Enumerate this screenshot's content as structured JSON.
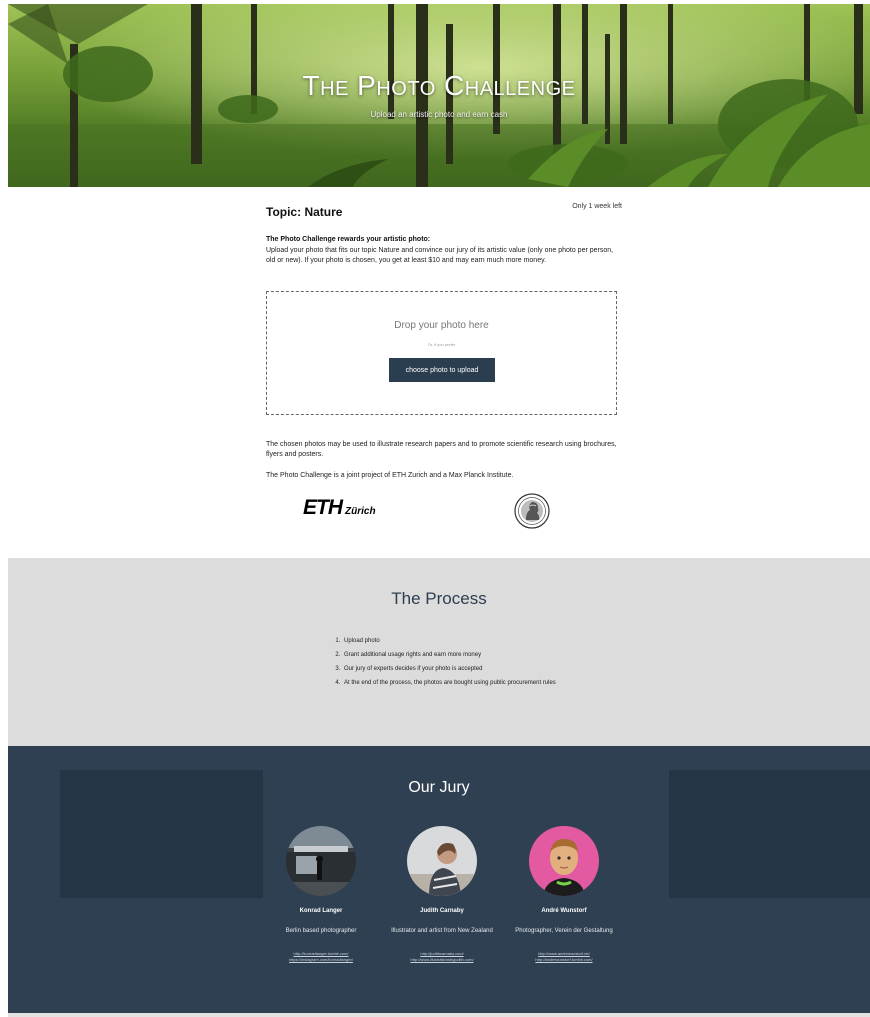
{
  "hero": {
    "title": "The Photo Challenge",
    "subtitle": "Upload an artistic photo and earn cash"
  },
  "topic": {
    "label": "Topic: Nature",
    "time_left": "Only 1 week left"
  },
  "intro": {
    "heading": "The Photo Challenge rewards your artistic photo:",
    "text": "Upload your photo that fits our topic Nature and convince our jury of its artistic value (only one photo per person, old or new). If your photo is chosen, you get at least $10 and may earn much more money."
  },
  "upload": {
    "drop_label": "Drop your photo here",
    "or_label": "Or, if you prefer",
    "button_label": "choose photo to upload"
  },
  "usage_text": "The chosen photos may be used to illustrate research papers and to promote scientific research using brochures, flyers and posters.",
  "joint_text": "The Photo Challenge is a joint project of ETH Zurich and a Max Planck Institute.",
  "logos": {
    "eth_mark": "ETH",
    "eth_city": "Zürich"
  },
  "process": {
    "title": "The Process",
    "steps": [
      "Upload photo",
      "Grant additional usage rights and earn more money",
      "Our jury of experts decides if your photo is accepted",
      "At the end of the process, the photos are bought using public procurement rules"
    ]
  },
  "jury": {
    "title": "Our Jury",
    "members": [
      {
        "name": "Konrad Langer",
        "desc": "Berlin based photographer",
        "links": [
          "http://konradlanger.tumblr.com/",
          "https://instagram.com/konradlanger/"
        ]
      },
      {
        "name": "Judith Carnaby",
        "desc": "Illustrator and artist from New Zealand",
        "links": [
          "http://judithcarnaby.com/",
          "http://www.illustrationsbyjudith.com/"
        ]
      },
      {
        "name": "André Wunstorf",
        "desc": "Photographer, Verein der Gestaltung",
        "links": [
          "http://www.andrewunstorf.de/",
          "http://andrewunstorf.tumblr.com/"
        ]
      }
    ]
  }
}
